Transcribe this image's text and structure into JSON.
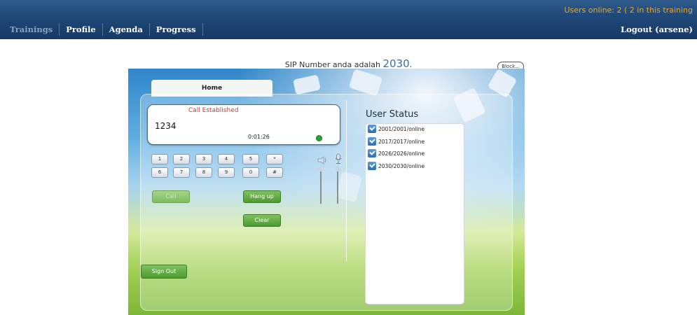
{
  "topbar": {
    "online_text": "Users online: 2 ( 2 in this training",
    "nav": [
      {
        "label": "Trainings",
        "active": true
      },
      {
        "label": "Profile",
        "active": false
      },
      {
        "label": "Agenda",
        "active": false
      },
      {
        "label": "Progress",
        "active": false
      }
    ],
    "logout_label": "Logout (arsene)"
  },
  "sip": {
    "prefix": "SIP Number anda adalah ",
    "number": "2030",
    "suffix": "."
  },
  "block_label": "Block...",
  "phone": {
    "tab_home": "Home",
    "call_status": "Call Established",
    "dialed_number": "1234",
    "timer": "0:01:26",
    "keypad_row1": [
      "1",
      "2",
      "3",
      "4",
      "5",
      "*"
    ],
    "keypad_row2": [
      "6",
      "7",
      "8",
      "9",
      "0",
      "#"
    ],
    "call_label": "Call",
    "hangup_label": "Hang up",
    "clear_label": "Clear",
    "signout_label": "Sign Out"
  },
  "user_status": {
    "title": "User Status",
    "users": [
      "2001/2001/online",
      "2017/2017/online",
      "2026/2026/online",
      "2030/2030/online"
    ]
  },
  "colors": {
    "nav_bg": "#204878",
    "online_text": "#e7a830",
    "call_status": "#c33b3b",
    "button_green": "#4c9b30",
    "led": "#33a33a"
  }
}
